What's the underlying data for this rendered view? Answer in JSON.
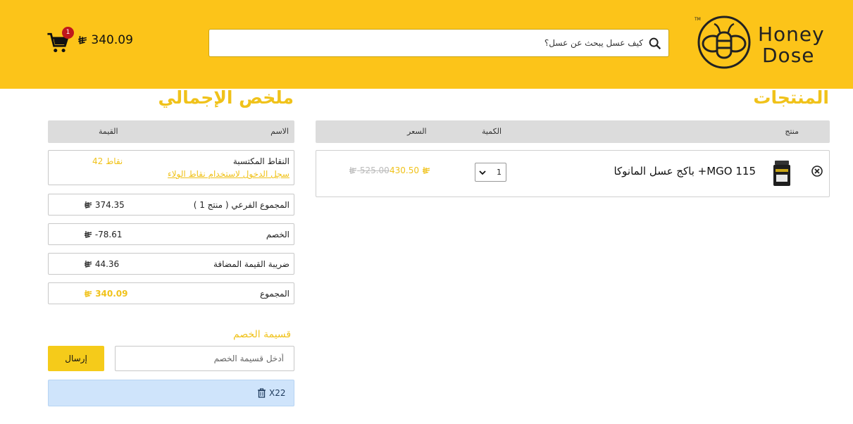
{
  "header": {
    "brand_line1": "Honey",
    "brand_line2": "Dose",
    "search_placeholder": "كيف عسل يبحث عن عسل؟",
    "cart": {
      "count": "1",
      "total": "340.09"
    }
  },
  "products": {
    "title": "المنتجات",
    "columns": {
      "product": "منتج",
      "quantity": "الكمية",
      "price": "السعر"
    },
    "items": [
      {
        "name": "باكج عسل المانوكا +MGO 115",
        "quantity": "1",
        "price": "430.50",
        "old_price": "525.00"
      }
    ]
  },
  "summary": {
    "title": "ملخص الإجمالي",
    "columns": {
      "name": "الاسم",
      "value": "القيمة"
    },
    "points_label": "النقاط المكتسبة",
    "points_value": "42 نقاط",
    "loyalty_link": "سجل الدخول لاستخدام نقاط الولاء",
    "subtotal_label": "المجموع الفرعي ( منتج 1 )",
    "subtotal_value": "374.35",
    "discount_label": "الخصم",
    "discount_value": "-78.61",
    "vat_label": "ضريبة القيمة المضافة",
    "vat_value": "44.36",
    "total_label": "المجموع",
    "total_value": "340.09"
  },
  "coupon": {
    "title": "قسيمة الخصم",
    "placeholder": "أدخل قسيمة الخصم",
    "submit_label": "إرسال",
    "applied_code": "X22"
  },
  "colors": {
    "brand_yellow": "#fcc419",
    "accent_gold": "#f0c21a",
    "badge_red": "#c0171c",
    "coupon_blue": "#cfe4fb"
  },
  "icons": [
    "bee-logo-icon",
    "search-icon",
    "cart-icon",
    "remove-icon",
    "chevron-down-icon",
    "trash-icon",
    "riyal-icon"
  ]
}
